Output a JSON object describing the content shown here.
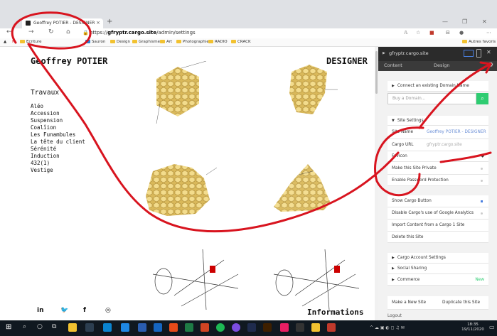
{
  "browser": {
    "tab_title": "Geoffrey POTIER - DESIGNER",
    "url_prefix": "https://",
    "url_domain": "gfryptr.cargo.site",
    "url_path": "/admin/settings",
    "bookmarks": [
      "Ecriture",
      "Sauron",
      "Design",
      "Graphisme",
      "Art",
      "Photographie",
      "RADIO",
      "CRACK"
    ],
    "other_bookmarks": "Autres favoris"
  },
  "site": {
    "title": "Geoffrey POTIER",
    "designer_label": "DESIGNER",
    "section_title": "Travaux",
    "projects": [
      "Aléo",
      "Accession",
      "Suspension",
      "Coalîion",
      "Les Funambules",
      "La tête du client",
      "Sérénité",
      "Induction",
      "432(1)",
      "Vestige"
    ],
    "social": [
      "in",
      "🐦",
      "f",
      "◎"
    ],
    "info_link": "Informations"
  },
  "panel": {
    "site_name_header": "gfryptr.cargo.site",
    "tab_content": "Content",
    "tab_design": "Design",
    "connect_domain": "Connect an existing Domain Name",
    "buy_domain_placeholder": "Buy a Domain...",
    "site_settings": "Site Settings",
    "site_name_label": "Site Name",
    "site_name_value": "Geoffrey POTIER - DESIGNER",
    "cargo_url_label": "Cargo URL",
    "cargo_url_value": "gfryptr.cargo.site",
    "favicon_label": "Favicon",
    "make_private": "Make this Site Private",
    "enable_password": "Enable Password Protection",
    "show_cargo_button": "Show Cargo Button",
    "disable_analytics": "Disable Cargo's use of Google Analytics",
    "import_content": "Import Content from a Cargo 1 Site",
    "delete_site": "Delete this Site",
    "account_settings": "Cargo Account Settings",
    "social_sharing": "Social Sharing",
    "commerce": "Commerce",
    "commerce_badge": "New",
    "make_new_site": "Make a New Site",
    "duplicate_site": "Duplicate this Site",
    "logout": "Logout"
  },
  "taskbar": {
    "time": "18:35",
    "date": "19/11/2020"
  },
  "colors": {
    "accent_green": "#2ecc71",
    "link_blue": "#6b8fd6",
    "annotation_red": "#d8141f"
  }
}
